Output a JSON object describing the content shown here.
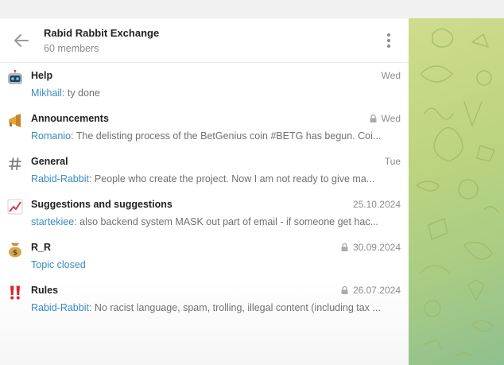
{
  "header": {
    "title": "Rabid Rabbit Exchange",
    "subtitle": "60 members"
  },
  "topics": [
    {
      "icon": "robot-icon",
      "name": "Help",
      "date": "Wed",
      "locked": false,
      "sender": "Mikhail",
      "separator": ": ",
      "text": "ty done"
    },
    {
      "icon": "megaphone-icon",
      "name": "Announcements",
      "date": "Wed",
      "locked": true,
      "sender": "Romanio",
      "separator": ": ",
      "text": "The delisting process of the BetGenius  coin #BETG has begun. Coi..."
    },
    {
      "icon": "hash-icon",
      "name": "General",
      "date": "Tue",
      "locked": false,
      "sender": "Rabid-Rabbit",
      "separator": ": ",
      "text": "People who create the project. Now I am not ready to give ma..."
    },
    {
      "icon": "chart-increasing-icon",
      "name": "Suggestions and suggestions",
      "date": "25.10.2024",
      "locked": false,
      "sender": "startekiee",
      "separator": ": ",
      "text": "also backend system MASK out part of email - if someone get hac..."
    },
    {
      "icon": "money-bag-icon",
      "name": "R_R",
      "date": "30.09.2024",
      "locked": true,
      "sender": "Topic closed",
      "separator": "",
      "text": ""
    },
    {
      "icon": "double-exclamation-icon",
      "name": "Rules",
      "date": "26.07.2024",
      "locked": true,
      "sender": "Rabid-Rabbit",
      "separator": ": ",
      "text": "No racist language, spam, trolling, illegal content (including tax ..."
    }
  ],
  "colors": {
    "accent": "#3a8ac4",
    "muted": "#8c8c8c",
    "wallpaper": "#c3d781"
  }
}
